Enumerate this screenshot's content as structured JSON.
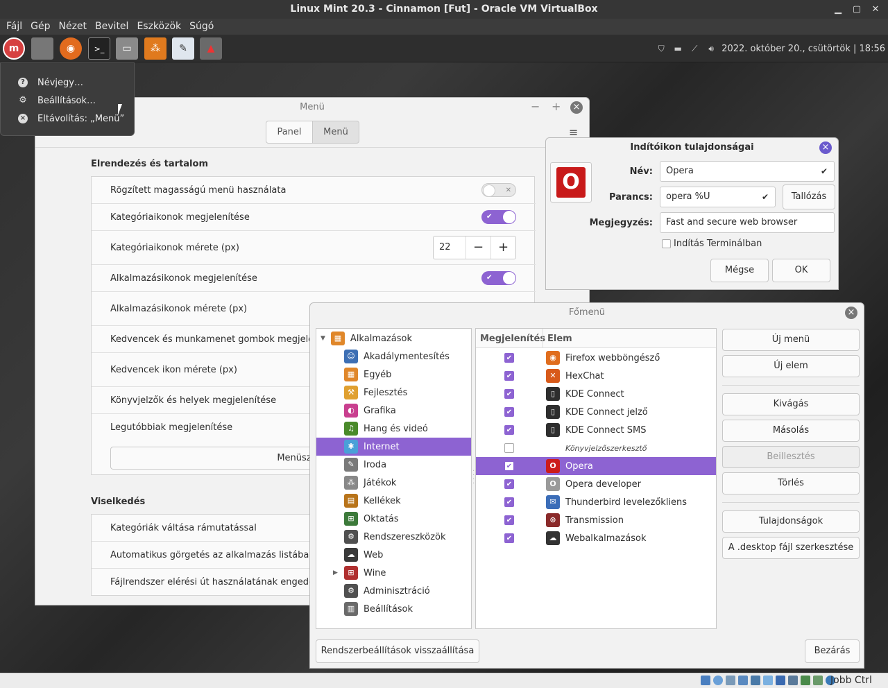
{
  "vbox": {
    "title": "Linux Mint 20.3 - Cinnamon [Fut] - Oracle VM VirtualBox",
    "menu": [
      "Fájl",
      "Gép",
      "Nézet",
      "Bevitel",
      "Eszközök",
      "Súgó"
    ],
    "host_key": "Jobb Ctrl"
  },
  "panel": {
    "clock": "2022. október 20., csütörtök | 18:56"
  },
  "context_menu": {
    "items": [
      "Névjegy…",
      "Beállítások…",
      "Eltávolítás: „Menü”"
    ]
  },
  "menu_settings": {
    "title": "Menü",
    "tabs": [
      "Panel",
      "Menü"
    ],
    "section1_title": "Elrendezés és tartalom",
    "rows": [
      {
        "label": "Rögzített magasságú menü használata",
        "toggle": false
      },
      {
        "label": "Kategóriaikonok megjelenítése",
        "toggle": true
      },
      {
        "label": "Kategóriaikonok mérete (px)",
        "spin": "22"
      },
      {
        "label": "Alkalmazásikonok megjelenítése",
        "toggle": true
      },
      {
        "label": "Alkalmazásikonok mérete (px)"
      },
      {
        "label": "Kedvencek és munkamenet gombok megjelenítése"
      },
      {
        "label": "Kedvencek ikon mérete (px)"
      },
      {
        "label": "Könyvjelzők és helyek megjelenítése"
      },
      {
        "label": "Legutóbbiak megjelenítése"
      }
    ],
    "editor_button": "Menüszerkesztő",
    "section2_title": "Viselkedés",
    "rows2": [
      "Kategóriák váltása rámutatással",
      "Automatikus görgetés az alkalmazás listában",
      "Fájlrendszer elérési út használatának engedélyezése"
    ]
  },
  "launcher_props": {
    "title": "Indítóikon tulajdonságai",
    "name_label": "Név:",
    "name_value": "Opera",
    "command_label": "Parancs:",
    "command_value": "opera %U",
    "browse_button": "Tallózás",
    "comment_label": "Megjegyzés:",
    "comment_value": "Fast and secure web browser",
    "terminal_label": "Indítás Terminálban",
    "cancel_button": "Mégse",
    "ok_button": "OK"
  },
  "main_menu": {
    "title": "Főmenü",
    "root": "Alkalmazások",
    "categories": [
      {
        "label": "Akadálymentesítés",
        "color": "#3d6fb4",
        "glyph": "☺"
      },
      {
        "label": "Egyéb",
        "color": "#e0872a",
        "glyph": "▦"
      },
      {
        "label": "Fejlesztés",
        "color": "#e0a030",
        "glyph": "⚒"
      },
      {
        "label": "Grafika",
        "color": "#c93f8f",
        "glyph": "◐"
      },
      {
        "label": "Hang és videó",
        "color": "#4a8a2a",
        "glyph": "♫"
      },
      {
        "label": "Internet",
        "color": "#4aa0d8",
        "glyph": "✱"
      },
      {
        "label": "Iroda",
        "color": "#7a7a7a",
        "glyph": "✎"
      },
      {
        "label": "Játékok",
        "color": "#888888",
        "glyph": "⁂"
      },
      {
        "label": "Kellékek",
        "color": "#b8741a",
        "glyph": "▤"
      },
      {
        "label": "Oktatás",
        "color": "#3c7a3a",
        "glyph": "⊞"
      },
      {
        "label": "Rendszereszközök",
        "color": "#505050",
        "glyph": "⚙"
      },
      {
        "label": "Web",
        "color": "#3a3a3a",
        "glyph": "☁"
      },
      {
        "label": "Wine",
        "color": "#b03030",
        "glyph": "⊞"
      },
      {
        "label": "Adminisztráció",
        "color": "#505050",
        "glyph": "⚙"
      },
      {
        "label": "Beállítások",
        "color": "#6a6a6a",
        "glyph": "▥"
      }
    ],
    "col_show": "Megjelenítés",
    "col_item": "Elem",
    "items": [
      {
        "label": "Firefox webböngésző",
        "checked": true,
        "color": "#e06d1e",
        "glyph": "◉"
      },
      {
        "label": "HexChat",
        "checked": true,
        "color": "#d85a1a",
        "glyph": "✕"
      },
      {
        "label": "KDE Connect",
        "checked": true,
        "color": "#2e2e2e",
        "glyph": "▯"
      },
      {
        "label": "KDE Connect jelző",
        "checked": true,
        "color": "#2e2e2e",
        "glyph": "▯"
      },
      {
        "label": "KDE Connect SMS",
        "checked": true,
        "color": "#2e2e2e",
        "glyph": "▯"
      },
      {
        "label": "Könyvjelzőszerkesztő",
        "checked": false,
        "color": "",
        "glyph": ""
      },
      {
        "label": "Opera",
        "checked": true,
        "color": "#cc1b1b",
        "glyph": "O"
      },
      {
        "label": "Opera developer",
        "checked": true,
        "color": "#9a9a9a",
        "glyph": "O"
      },
      {
        "label": "Thunderbird levelezőkliens",
        "checked": true,
        "color": "#3b6db8",
        "glyph": "✉"
      },
      {
        "label": "Transmission",
        "checked": true,
        "color": "#8a2a2a",
        "glyph": "⊙"
      },
      {
        "label": "Webalkalmazások",
        "checked": true,
        "color": "#333333",
        "glyph": "☁"
      }
    ],
    "buttons": {
      "new_menu": "Új menü",
      "new_item": "Új elem",
      "cut": "Kivágás",
      "copy": "Másolás",
      "paste": "Beillesztés",
      "delete": "Törlés",
      "properties": "Tulajdonságok",
      "edit_desktop": "A .desktop fájl szerkesztése",
      "restore": "Rendszerbeállítások visszaállítása",
      "close": "Bezárás"
    }
  }
}
